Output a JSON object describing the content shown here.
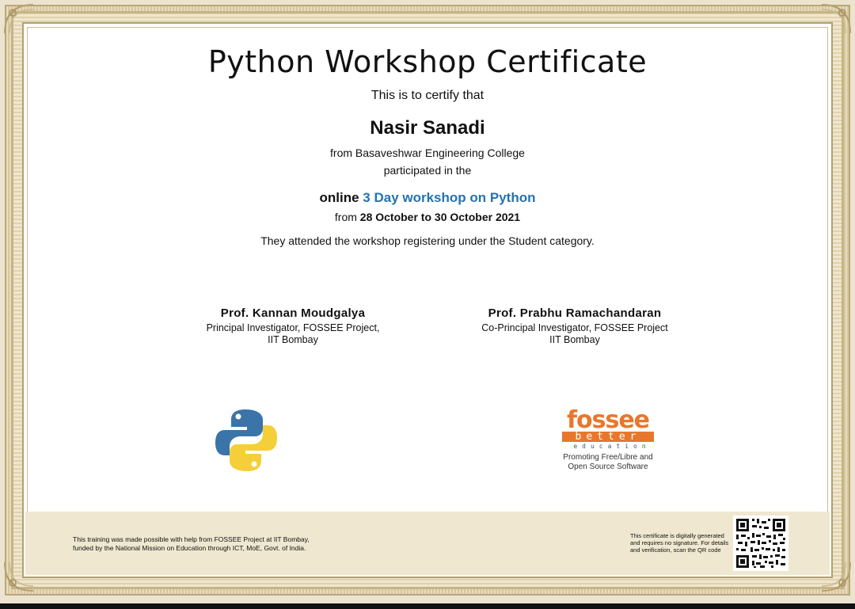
{
  "certificate": {
    "title": "Python Workshop Certificate",
    "certify_line": "This is to certify that",
    "participant_name": "Nasir Sanadi",
    "college_line": "from Basaveshwar Engineering College",
    "participated_line": "participated in the",
    "workshop_mode": "online",
    "workshop_name": "3 Day workshop on Python",
    "dates_prefix": "from",
    "dates": "28 October to 30 October 2021",
    "attendance_line": "They attended the workshop registering under the Student category."
  },
  "signatories": [
    {
      "name": "Prof. Kannan Moudgalya",
      "role": "Principal Investigator, FOSSEE Project,",
      "institution": "IIT Bombay"
    },
    {
      "name": "Prof. Prabhu Ramachandaran",
      "role": "Co-Principal Investigator, FOSSEE Project",
      "institution": "IIT Bombay"
    }
  ],
  "fossee_logo": {
    "wordmark": "fossee",
    "tag_top": "better",
    "tag_bottom": "education",
    "tagline_line1": "Promoting Free/Libre and",
    "tagline_line2": "Open Source Software"
  },
  "footer": {
    "funding_line1": "This training was made possible with help from FOSSEE Project at IIT Bombay,",
    "funding_line2": "funded by the National Mission on Education through ICT, MoE, Govt. of India.",
    "verification_line1": "This certificate is digitally generated",
    "verification_line2": "and requires no signature. For details",
    "verification_line3": "and verification, scan the QR code"
  },
  "icons": {
    "python": "python-logo-icon",
    "qr": "qr-code-icon"
  },
  "colors": {
    "workshop_name": "#2473b0",
    "python_blue": "#3a74a8",
    "python_yellow": "#f4cf3a",
    "fossee_orange": "#e8772d",
    "border_gold": "#b9a77c",
    "footer_band": "#efe7d0"
  }
}
